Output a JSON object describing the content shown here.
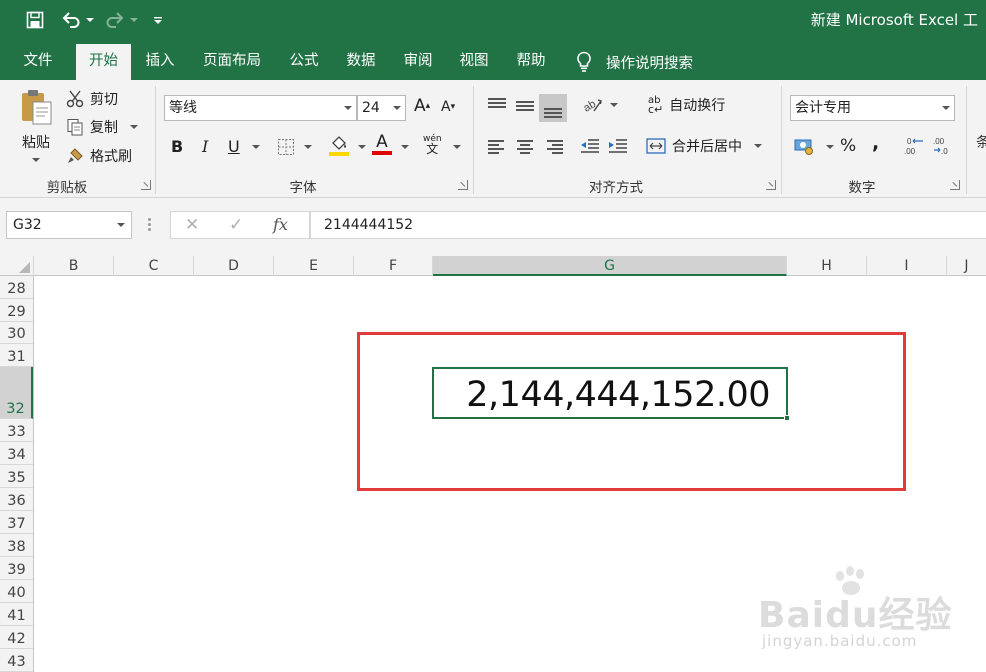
{
  "window": {
    "title": "新建 Microsoft Excel 工"
  },
  "tabs": [
    {
      "label": "文件",
      "active": false
    },
    {
      "label": "开始",
      "active": true
    },
    {
      "label": "插入",
      "active": false
    },
    {
      "label": "页面布局",
      "active": false
    },
    {
      "label": "公式",
      "active": false
    },
    {
      "label": "数据",
      "active": false
    },
    {
      "label": "审阅",
      "active": false
    },
    {
      "label": "视图",
      "active": false
    },
    {
      "label": "帮助",
      "active": false
    }
  ],
  "tell_me": "操作说明搜索",
  "ribbon": {
    "clipboard": {
      "paste": "粘贴",
      "cut": "剪切",
      "copy": "复制",
      "format_painter": "格式刷",
      "label": "剪贴板"
    },
    "font": {
      "name": "等线",
      "size": "24",
      "label": "字体",
      "bold": "B",
      "italic": "I",
      "underline": "U",
      "font_color_glyph": "A",
      "phonetic_top": "wén",
      "phonetic_bottom": "文"
    },
    "alignment": {
      "wrap_text": "自动换行",
      "merge_center": "合并后居中",
      "label": "对齐方式",
      "wrap_glyph": "ab"
    },
    "number": {
      "format": "会计专用",
      "percent": "%",
      "comma": ",",
      "label": "数字"
    },
    "cut_off_label": "条"
  },
  "formula_bar": {
    "name_box": "G32",
    "content": "2144444152",
    "fx": "fx"
  },
  "columns": [
    "B",
    "C",
    "D",
    "E",
    "F",
    "G",
    "H",
    "I",
    "J"
  ],
  "rows": [
    "28",
    "29",
    "30",
    "31",
    "32",
    "33",
    "34",
    "35",
    "36",
    "37",
    "38",
    "39",
    "40",
    "41",
    "42",
    "43"
  ],
  "selected_cell": {
    "column": "G",
    "row": "32",
    "display": "2,144,444,152.00"
  },
  "watermark": {
    "brand": "Baidu经验",
    "url": "jingyan.baidu.com"
  },
  "colors": {
    "excel_green": "#217346",
    "highlight_red": "#e23b3b",
    "font_color_red": "#e00000",
    "fill_yellow": "#ffd700"
  }
}
